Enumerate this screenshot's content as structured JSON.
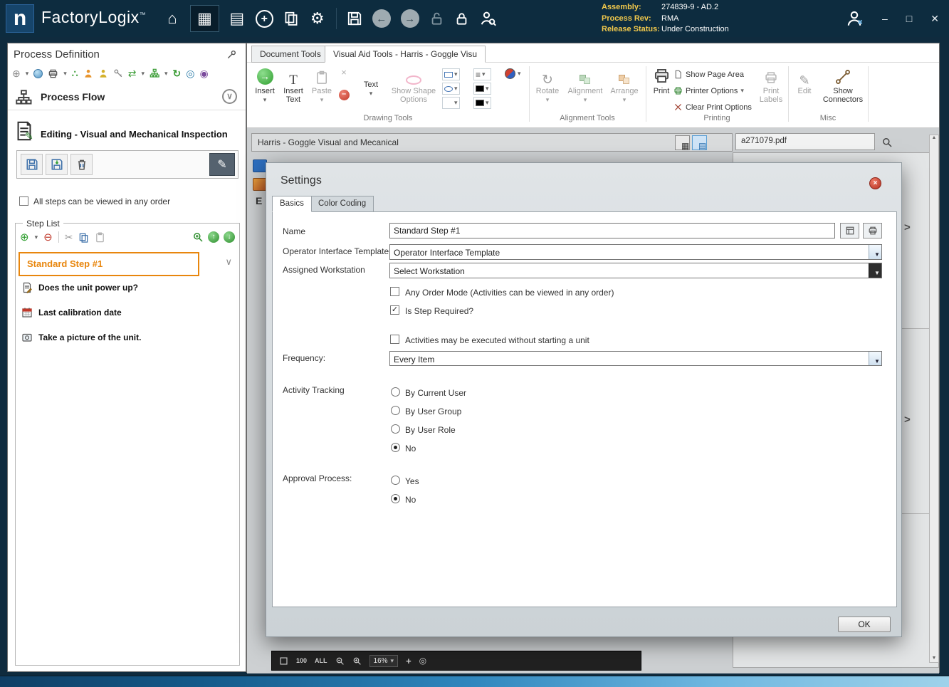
{
  "palette": {
    "titlebar_bg": "#0d2c3f",
    "accent_orange": "#e8860d",
    "close_red": "#c0392b",
    "highlight_blue": "#5a9fd4"
  },
  "icons": {
    "home": "⌂",
    "grid": "▦",
    "pages": "▤",
    "gear": "⚙",
    "back": "←",
    "forward": "→",
    "plus": "+",
    "dropdown": "▾",
    "combo_arrow": "▼",
    "chevron_down": "∨",
    "chevron_right": ">",
    "up_tri": "▲",
    "down_tri": "▼",
    "add_circle": "⊕",
    "remove_circle": "⊖",
    "cut": "✂",
    "refresh": "↻",
    "sync": "⇄",
    "dots": "∴",
    "pencil": "✎",
    "check": "✓",
    "close": "×",
    "minimize": "–",
    "maximize": "□",
    "minus": "–",
    "up": "↑",
    "down": "↓",
    "letter_T": "T",
    "lines": "≡",
    "target": "◎",
    "bullseye": "◉"
  },
  "titlebar": {
    "logo_letter": "n",
    "app_name": "FactoryLogix",
    "trademark": "™",
    "info": [
      {
        "label": "Assembly:",
        "value": "274839-9 - AD.2"
      },
      {
        "label": "Process Rev:",
        "value": "RMA"
      },
      {
        "label": "Release Status:",
        "value": "Under Construction"
      }
    ],
    "window": {
      "minimize": "–",
      "maximize": "□",
      "close": "✕"
    }
  },
  "left_panel": {
    "title": "Process Definition",
    "process_flow_label": "Process Flow",
    "editing_title": "Editing - Visual and Mechanical Inspection",
    "order_checkbox_label": "All steps can be viewed in any order",
    "step_list_title": "Step List",
    "steps": [
      {
        "label": "Standard Step #1"
      },
      {
        "label": "Does the unit power up?"
      },
      {
        "label": "Last calibration date"
      },
      {
        "label": "Take a picture of the unit."
      }
    ]
  },
  "ribbon": {
    "tabs": [
      {
        "label": "Document Tools"
      },
      {
        "label": "Visual Aid Tools - Harris - Goggle Visu"
      }
    ],
    "drawing": {
      "group_label": "Drawing Tools",
      "insert": "Insert",
      "insert_text_1": "Insert",
      "insert_text_2": "Text",
      "paste": "Paste",
      "text": "Text",
      "show_shape_options": "Show Shape Options"
    },
    "alignment": {
      "group_label": "Alignment Tools",
      "rotate": "Rotate",
      "alignment": "Alignment",
      "arrange": "Arrange"
    },
    "printing": {
      "group_label": "Printing",
      "print": "Print",
      "show_page_area": "Show Page Area",
      "printer_options": "Printer Options",
      "clear_print_options": "Clear Print Options",
      "print_labels_1": "Print",
      "print_labels_2": "Labels"
    },
    "misc": {
      "group_label": "Misc",
      "edit": "Edit",
      "show_connectors_1": "Show",
      "show_connectors_2": "Connectors"
    }
  },
  "document": {
    "title": "Harris - Goggle Visual and Mecanical",
    "side_label": "E",
    "pdf_name": "a271079.pdf",
    "zoom_value": "16%",
    "toolbar_100": "100",
    "toolbar_all": "ALL"
  },
  "dialog": {
    "title": "Settings",
    "tabs": [
      {
        "label": "Basics"
      },
      {
        "label": "Color Coding"
      }
    ],
    "name_label": "Name",
    "name_value": "Standard Step #1",
    "oit_label": "Operator Interface Template",
    "oit_value": "Operator Interface Template",
    "workstation_label": "Assigned Workstation",
    "workstation_value": "Select Workstation",
    "any_order_label": "Any Order Mode (Activities can be viewed in any order)",
    "required_label": "Is Step Required?",
    "activities_label": "Activities may be executed without starting a unit",
    "frequency_label": "Frequency:",
    "frequency_value": "Every Item",
    "tracking_label": "Activity Tracking",
    "tracking_options": [
      {
        "label": "By Current User"
      },
      {
        "label": "By User Group"
      },
      {
        "label": "By User Role"
      },
      {
        "label": "No"
      }
    ],
    "approval_label": "Approval Process:",
    "approval_options": [
      {
        "label": "Yes"
      },
      {
        "label": "No"
      }
    ],
    "ok_label": "OK"
  }
}
